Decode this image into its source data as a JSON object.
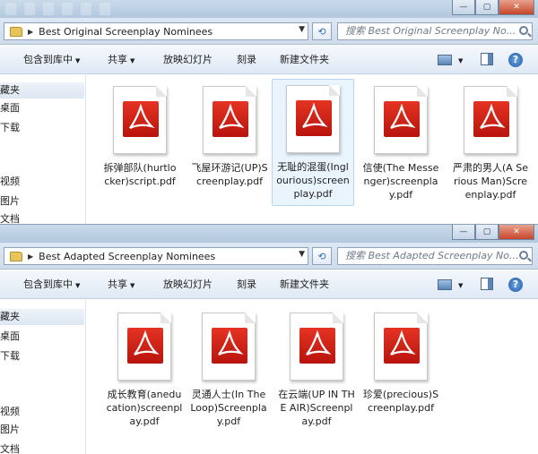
{
  "windows": [
    {
      "breadcrumb": "Best Original Screenplay Nominees",
      "search_placeholder": "搜索 Best Original Screenplay No...",
      "toolbar": {
        "include": "包含到库中",
        "share": "共享",
        "slideshow": "放映幻灯片",
        "burn": "刻录",
        "new_folder": "新建文件夹",
        "help": "?"
      },
      "nav": [
        "藏夹",
        "桌面",
        "下载",
        "",
        "视频",
        "图片",
        "文档"
      ],
      "files": [
        "拆弹部队(hurtlocker)script.pdf",
        "飞屋环游记(UP)Screenplay.pdf",
        "无耻的混蛋(Inglourious)screenplay.pdf",
        "信使(The Messenger)screenplay.pdf",
        "严肃的男人(A Serious Man)Screenplay.pdf"
      ]
    },
    {
      "breadcrumb": "Best Adapted Screenplay Nominees",
      "search_placeholder": "搜索 Best Adapted Screenplay No...",
      "toolbar": {
        "include": "包含到库中",
        "share": "共享",
        "slideshow": "放映幻灯片",
        "burn": "刻录",
        "new_folder": "新建文件夹",
        "help": "?"
      },
      "nav": [
        "藏夹",
        "桌面",
        "下载",
        "",
        "视频",
        "图片",
        "文档"
      ],
      "files": [
        "成长教育(aneducation)screenplay.pdf",
        "灵通人士(In The Loop)Screenplay.pdf",
        "在云端(UP IN THE AIR)Screenplay.pdf",
        "珍爱(precious)Screenplay.pdf"
      ]
    }
  ],
  "colors": {
    "pdf_red": "#d0201a",
    "chrome": "#c9daea",
    "selection": "#eaf4fd"
  }
}
